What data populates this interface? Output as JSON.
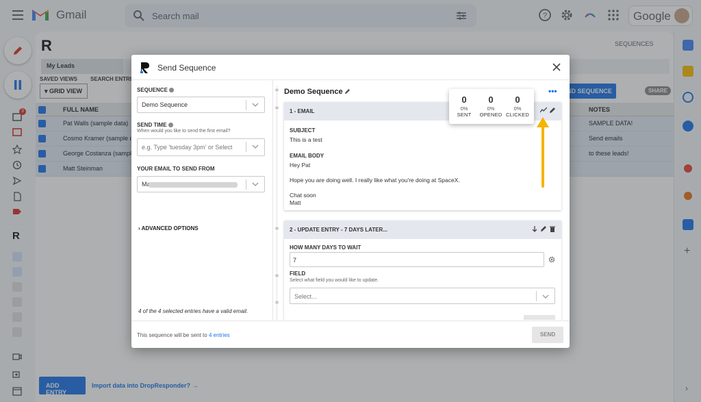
{
  "gmail": {
    "logo_text": "Gmail",
    "search_placeholder": "Search mail",
    "account_brand": "Google",
    "inbox_badge": "3"
  },
  "app": {
    "sequences_link": "SEQUENCES",
    "tabs": [
      "My Leads"
    ],
    "saved_views_label": "SAVED VIEWS",
    "search_entries_label": "SEARCH ENTRI",
    "grid_view_button": "GRID VIEW",
    "send_sequence_button": "ND SEQUENCE",
    "share_button": "SHARE",
    "columns": {
      "full_name": "FULL NAME",
      "notes": "NOTES"
    },
    "rows": [
      {
        "name": "Pat Walls (sample data)",
        "notes": "SAMPLE DATA!"
      },
      {
        "name": "Cosmo Kramer (sample da",
        "notes": "Send emails"
      },
      {
        "name": "George Costanza (sample",
        "notes": "to these leads!"
      },
      {
        "name": "Matt Steinman",
        "notes": ""
      }
    ],
    "add_entry_button": "ADD ENTRY",
    "import_link": "Import data into DropResponder? →"
  },
  "modal": {
    "title": "Send Sequence",
    "sequence_label": "SEQUENCE",
    "sequence_value": "Demo Sequence",
    "send_time_label": "SEND TIME",
    "send_time_sub": "When would you like to send the first email?",
    "send_time_placeholder": "e.g. Type 'tuesday 3pm' or Select",
    "from_label": "YOUR EMAIL TO SEND FROM",
    "from_value_prefix": "Ma",
    "advanced_options": "ADVANCED OPTIONS",
    "valid_note": "4 of the 4 selected entries have a valid email.",
    "footer_text": "This sequence will be sent to ",
    "footer_link": "4 entries",
    "send_button": "SEND",
    "sequence_name": "Demo Sequence",
    "steps": [
      {
        "title": "1 - EMAIL",
        "subject_label": "SUBJECT",
        "subject": "This is a test",
        "body_label": "EMAIL BODY",
        "body_lines": [
          "Hey Pat",
          "Hope you are doing well. I really like what you're doing at SpaceX.",
          "Chat soon",
          "Matt"
        ]
      },
      {
        "title": "2 - UPDATE ENTRY - 7 DAYS LATER...",
        "days_label": "HOW MANY DAYS TO WAIT",
        "days_value": "7",
        "field_label": "FIELD",
        "field_sub": "Select what field you would like to update.",
        "field_placeholder": "Select..."
      }
    ]
  },
  "stats": [
    {
      "count": "0",
      "pct": "0%",
      "label": "SENT"
    },
    {
      "count": "0",
      "pct": "0%",
      "label": "OPENED"
    },
    {
      "count": "0",
      "pct": "0%",
      "label": "CLICKED"
    }
  ],
  "colors": {
    "accent": "#1a73e8",
    "arrow": "#f5b400",
    "card_header": "#e4e8ee"
  }
}
